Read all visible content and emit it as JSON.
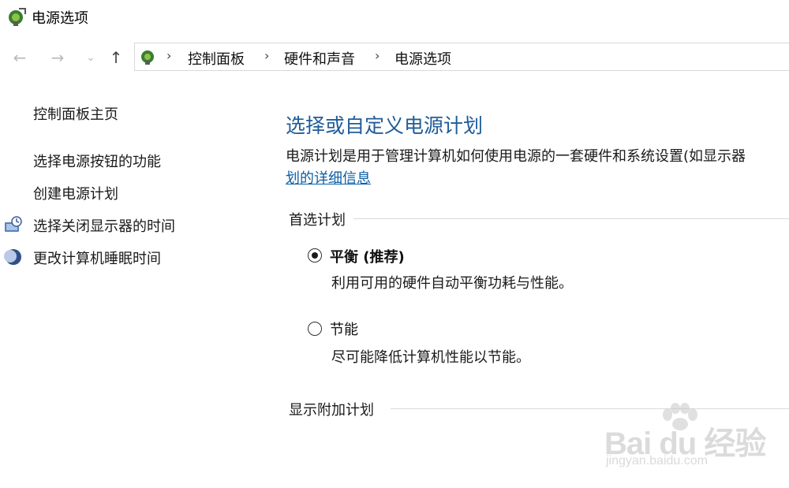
{
  "window": {
    "title": "电源选项",
    "icon": "power-options-icon"
  },
  "nav": {
    "back_icon": "back-arrow-icon",
    "forward_icon": "forward-arrow-icon",
    "recent_icon": "chevron-down-icon",
    "up_icon": "up-arrow-icon",
    "breadcrumb": [
      "控制面板",
      "硬件和声音",
      "电源选项"
    ],
    "separator": "›"
  },
  "sidebar": {
    "home": "控制面板主页",
    "links": [
      "选择电源按钮的功能",
      "创建电源计划",
      "选择关闭显示器的时间",
      "更改计算机睡眠时间"
    ]
  },
  "main": {
    "title": "选择或自定义电源计划",
    "description": "电源计划是用于管理计算机如何使用电源的一套硬件和系统设置(如显示器",
    "details_link": "划的详细信息",
    "preferred_group": "首选计划",
    "plans": [
      {
        "name": "平衡 (推荐)",
        "description": "利用可用的硬件自动平衡功耗与性能。",
        "selected": true
      },
      {
        "name": "节能",
        "description": "尽可能降低计算机性能以节能。",
        "selected": false
      }
    ],
    "additional_group": "显示附加计划"
  },
  "watermark": {
    "brand": "Bai du 经验",
    "url": "jingyan.baidu.com"
  },
  "colors": {
    "title_blue": "#1f5c99",
    "link_blue": "#0b5ea6"
  }
}
